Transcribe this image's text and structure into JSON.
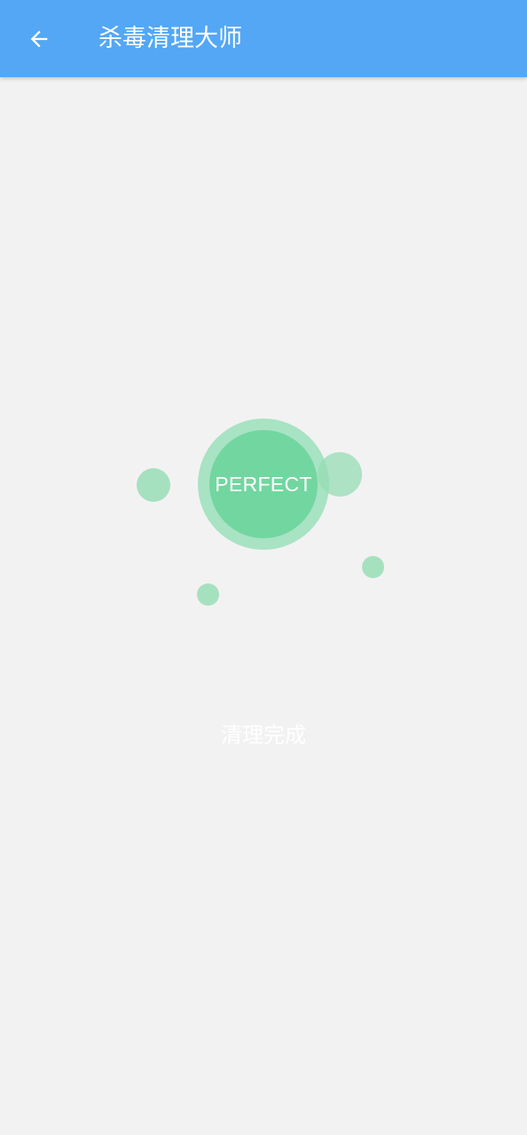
{
  "toolbar": {
    "back_icon": "arrow-left-icon",
    "title": "杀毒清理大师",
    "background_color": "#53a7f5"
  },
  "result": {
    "badge_text": "PERFECT",
    "status_text": "清理完成",
    "circle_color": "#72d6a0",
    "bubble_color": "#a6e1bf"
  }
}
